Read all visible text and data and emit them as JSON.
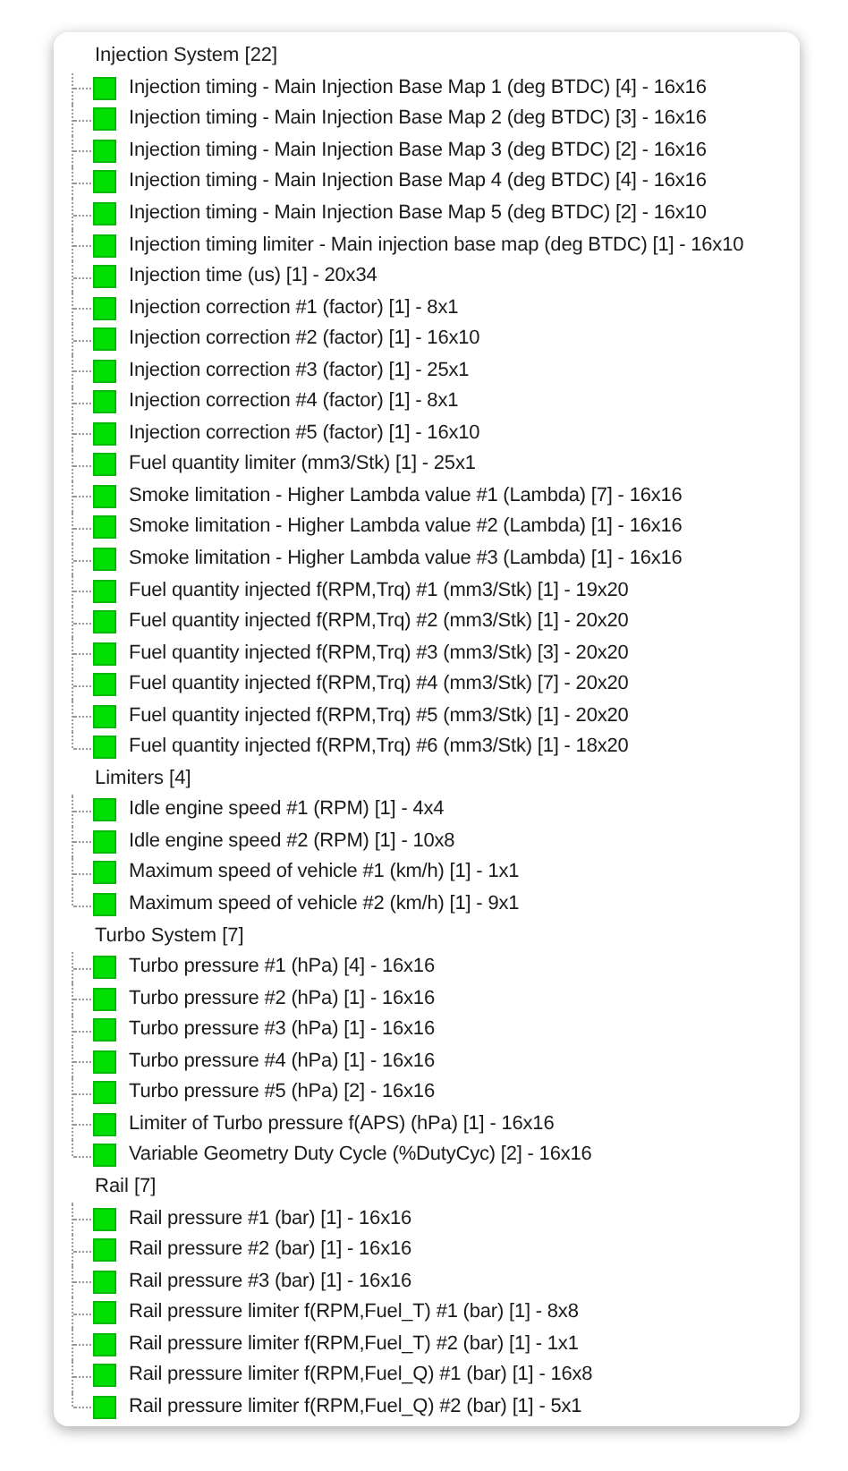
{
  "tree": [
    {
      "label": "Injection System [22]",
      "children": [
        {
          "label": "Injection timing - Main Injection Base Map 1 (deg BTDC) [4] - 16x16"
        },
        {
          "label": "Injection timing - Main Injection Base Map 2 (deg BTDC) [3] - 16x16"
        },
        {
          "label": "Injection timing - Main Injection Base Map 3 (deg BTDC) [2] - 16x16"
        },
        {
          "label": "Injection timing - Main Injection Base Map 4 (deg BTDC) [4] - 16x16"
        },
        {
          "label": "Injection timing - Main Injection Base Map 5 (deg BTDC) [2] - 16x10"
        },
        {
          "label": "Injection timing limiter - Main injection base map (deg BTDC) [1] - 16x10"
        },
        {
          "label": "Injection time (us) [1] - 20x34"
        },
        {
          "label": "Injection correction #1 (factor) [1] - 8x1"
        },
        {
          "label": "Injection correction #2 (factor) [1] - 16x10"
        },
        {
          "label": "Injection correction #3 (factor) [1] - 25x1"
        },
        {
          "label": "Injection correction #4 (factor) [1] - 8x1"
        },
        {
          "label": "Injection correction #5 (factor) [1] - 16x10"
        },
        {
          "label": "Fuel quantity limiter (mm3/Stk) [1] - 25x1"
        },
        {
          "label": "Smoke limitation - Higher Lambda value #1 (Lambda) [7] - 16x16"
        },
        {
          "label": "Smoke limitation - Higher Lambda value #2 (Lambda) [1] - 16x16"
        },
        {
          "label": "Smoke limitation - Higher Lambda value #3 (Lambda) [1] - 16x16"
        },
        {
          "label": "Fuel quantity injected f(RPM,Trq) #1 (mm3/Stk) [1] - 19x20"
        },
        {
          "label": "Fuel quantity injected f(RPM,Trq) #2 (mm3/Stk) [1] - 20x20"
        },
        {
          "label": "Fuel quantity injected f(RPM,Trq) #3 (mm3/Stk) [3] - 20x20"
        },
        {
          "label": "Fuel quantity injected f(RPM,Trq) #4 (mm3/Stk) [7] - 20x20"
        },
        {
          "label": "Fuel quantity injected f(RPM,Trq) #5 (mm3/Stk) [1] - 20x20"
        },
        {
          "label": "Fuel quantity injected f(RPM,Trq) #6 (mm3/Stk) [1] - 18x20"
        }
      ]
    },
    {
      "label": "Limiters [4]",
      "children": [
        {
          "label": "Idle engine speed #1 (RPM) [1] - 4x4"
        },
        {
          "label": "Idle engine speed #2 (RPM) [1] - 10x8"
        },
        {
          "label": "Maximum speed of vehicle #1 (km/h) [1] - 1x1"
        },
        {
          "label": "Maximum speed of vehicle #2 (km/h) [1] - 9x1"
        }
      ]
    },
    {
      "label": "Turbo System [7]",
      "children": [
        {
          "label": "Turbo pressure #1 (hPa) [4] - 16x16"
        },
        {
          "label": "Turbo pressure #2 (hPa) [1] - 16x16"
        },
        {
          "label": "Turbo pressure #3 (hPa) [1] - 16x16"
        },
        {
          "label": "Turbo pressure #4 (hPa) [1] - 16x16"
        },
        {
          "label": "Turbo pressure #5 (hPa) [2] - 16x16"
        },
        {
          "label": "Limiter of Turbo pressure f(APS) (hPa) [1] - 16x16"
        },
        {
          "label": "Variable Geometry Duty Cycle (%DutyCyc) [2] - 16x16"
        }
      ]
    },
    {
      "label": "Rail [7]",
      "children": [
        {
          "label": "Rail pressure #1 (bar) [1] - 16x16"
        },
        {
          "label": "Rail pressure #2 (bar) [1] - 16x16"
        },
        {
          "label": "Rail pressure #3 (bar) [1] - 16x16"
        },
        {
          "label": "Rail pressure limiter f(RPM,Fuel_T) #1 (bar) [1] - 8x8"
        },
        {
          "label": "Rail pressure limiter f(RPM,Fuel_T) #2 (bar) [1] - 1x1"
        },
        {
          "label": "Rail pressure limiter f(RPM,Fuel_Q) #1 (bar) [1] - 16x8"
        },
        {
          "label": "Rail pressure limiter f(RPM,Fuel_Q) #2 (bar) [1] - 5x1"
        }
      ]
    }
  ]
}
